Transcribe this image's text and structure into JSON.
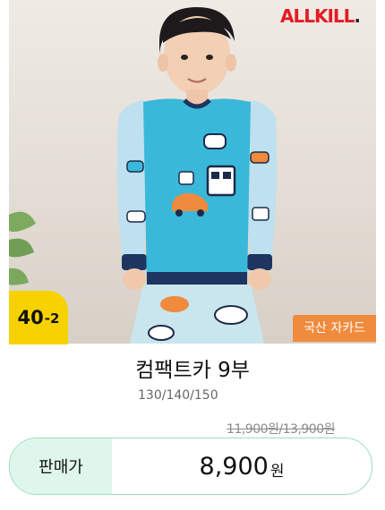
{
  "brand": {
    "name": "ALLKILL",
    "dot": "."
  },
  "badge": {
    "size_main": "40",
    "size_sub": "-2"
  },
  "tag": {
    "label": "국산 자카드"
  },
  "product": {
    "title": "컴팩트카 9부",
    "sizes": "130/140/150",
    "original_price": "11,900원/13,900원"
  },
  "price": {
    "label": "판매가",
    "value": "8,900",
    "unit": "원"
  },
  "colors": {
    "brand_red": "#e31b23",
    "badge_yellow": "#f7d200",
    "tag_orange": "#f08a3c",
    "price_label_bg": "#dff7eb",
    "price_border": "#9fdfc0",
    "shirt_blue": "#3ab8d9"
  }
}
